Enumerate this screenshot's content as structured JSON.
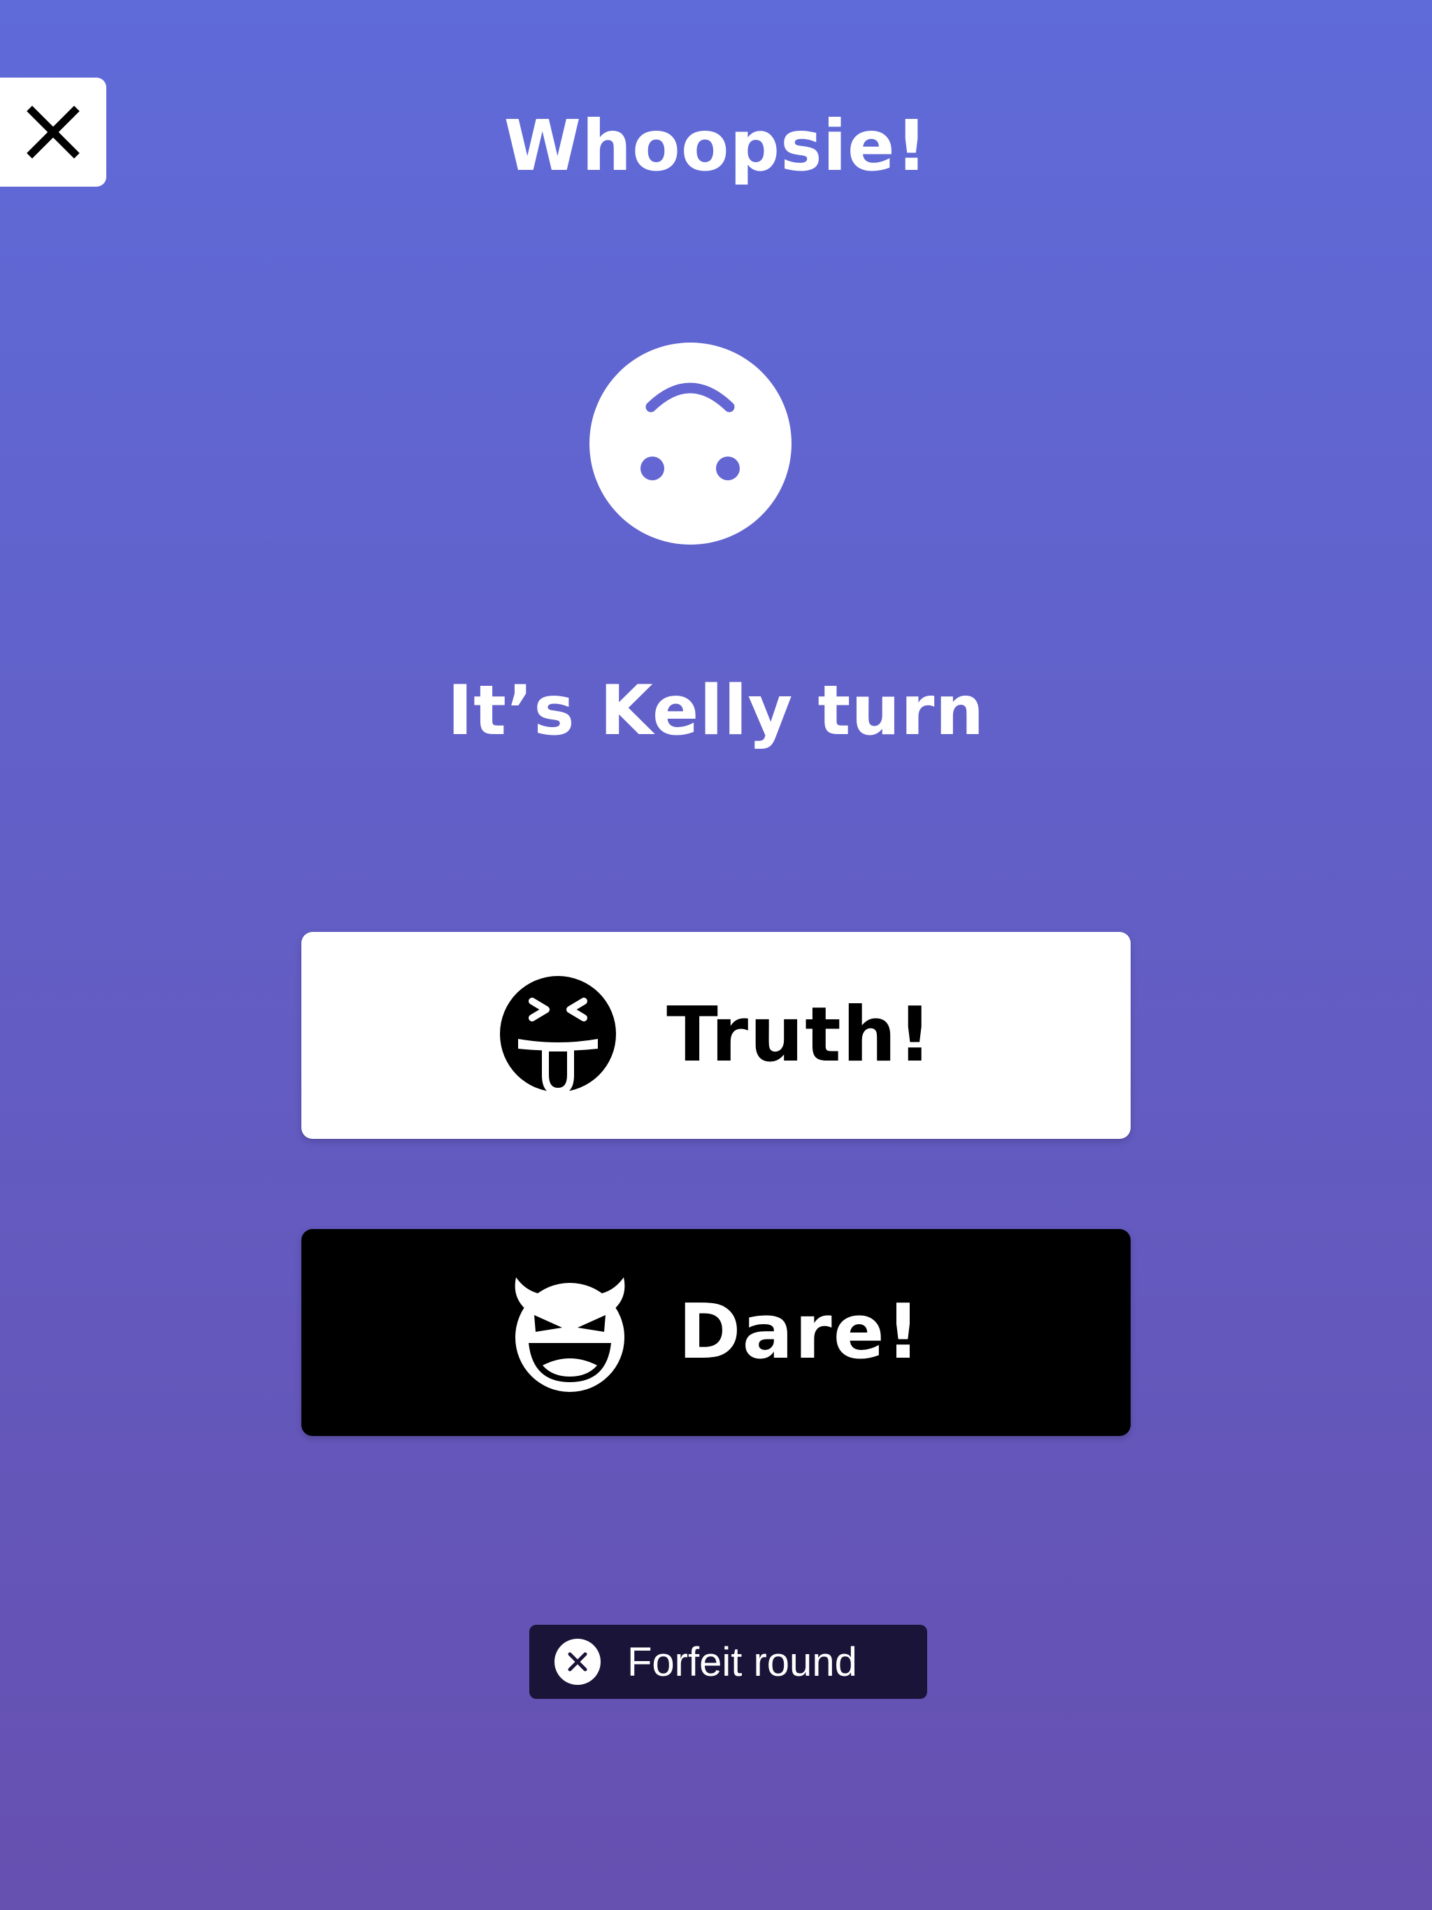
{
  "title": "Whoopsie!",
  "turn_text": "It’s Kelly turn",
  "choices": {
    "truth_label": "Truth!",
    "dare_label": "Dare!"
  },
  "forfeit_label": "Forfeit round",
  "icons": {
    "close": "close-icon",
    "mood": "upside-down-face-icon",
    "truth": "squinting-face-with-tongue-icon",
    "dare": "smiling-devil-icon",
    "forfeit": "circle-x-icon"
  },
  "colors": {
    "background_top": "#5f6bd9",
    "background_bottom": "#6650b0",
    "truth_button_bg": "#ffffff",
    "dare_button_bg": "#000000",
    "forfeit_button_bg": "#1a1438",
    "face_feature": "#6366d3"
  }
}
